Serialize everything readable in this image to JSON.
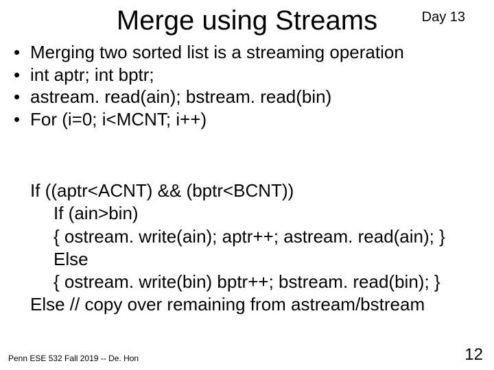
{
  "header": {
    "title": "Merge using Streams",
    "day": "Day 13"
  },
  "bullets": [
    "Merging two sorted list is a streaming operation",
    "int aptr; int bptr;",
    "astream. read(ain); bstream. read(bin)",
    "For (i=0; i<MCNT; i++)"
  ],
  "code": [
    "If ((aptr<ACNT) && (bptr<BCNT))",
    "If (ain>bin)",
    "{ ostream. write(ain); aptr++; astream. read(ain); }",
    "Else",
    "{ ostream. write(bin) bptr++; bstream. read(bin); }",
    "Else // copy over remaining from astream/bstream"
  ],
  "footer": {
    "text": "Penn ESE 532 Fall 2019 -- De. Hon",
    "page": "12"
  }
}
